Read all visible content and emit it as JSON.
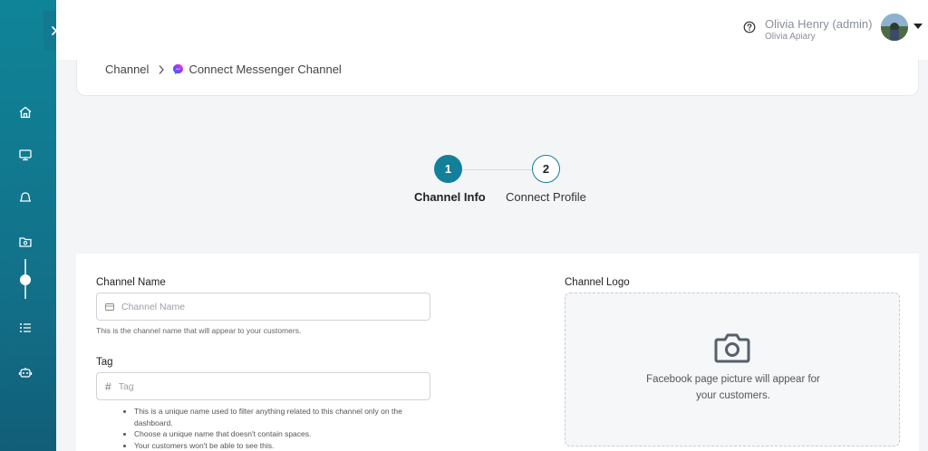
{
  "header": {
    "user_name": "Olivia Henry (admin)",
    "user_org": "Olivia Apiary"
  },
  "breadcrumb": {
    "root": "Channel",
    "current": "Connect Messenger Channel"
  },
  "stepper": {
    "steps": [
      {
        "number": "1",
        "label": "Channel Info"
      },
      {
        "number": "2",
        "label": "Connect Profile"
      }
    ]
  },
  "form": {
    "channel_name": {
      "label": "Channel Name",
      "placeholder": "Channel Name",
      "value": "",
      "help": "This is the channel name that will appear to your customers."
    },
    "tag": {
      "label": "Tag",
      "placeholder": "Tag",
      "value": "",
      "hints": [
        "This is a unique name used to filter anything related to this channel only on the dashboard.",
        "Choose a unique name that doesn't contain spaces.",
        "Your customers won't be able to see this."
      ]
    },
    "logo": {
      "label": "Channel Logo",
      "text_line1": "Facebook page picture will appear for",
      "text_line2": "your customers."
    }
  },
  "colors": {
    "primary": "#12809a",
    "sidebar_top": "#0f8498",
    "sidebar_bottom": "#115e78"
  }
}
